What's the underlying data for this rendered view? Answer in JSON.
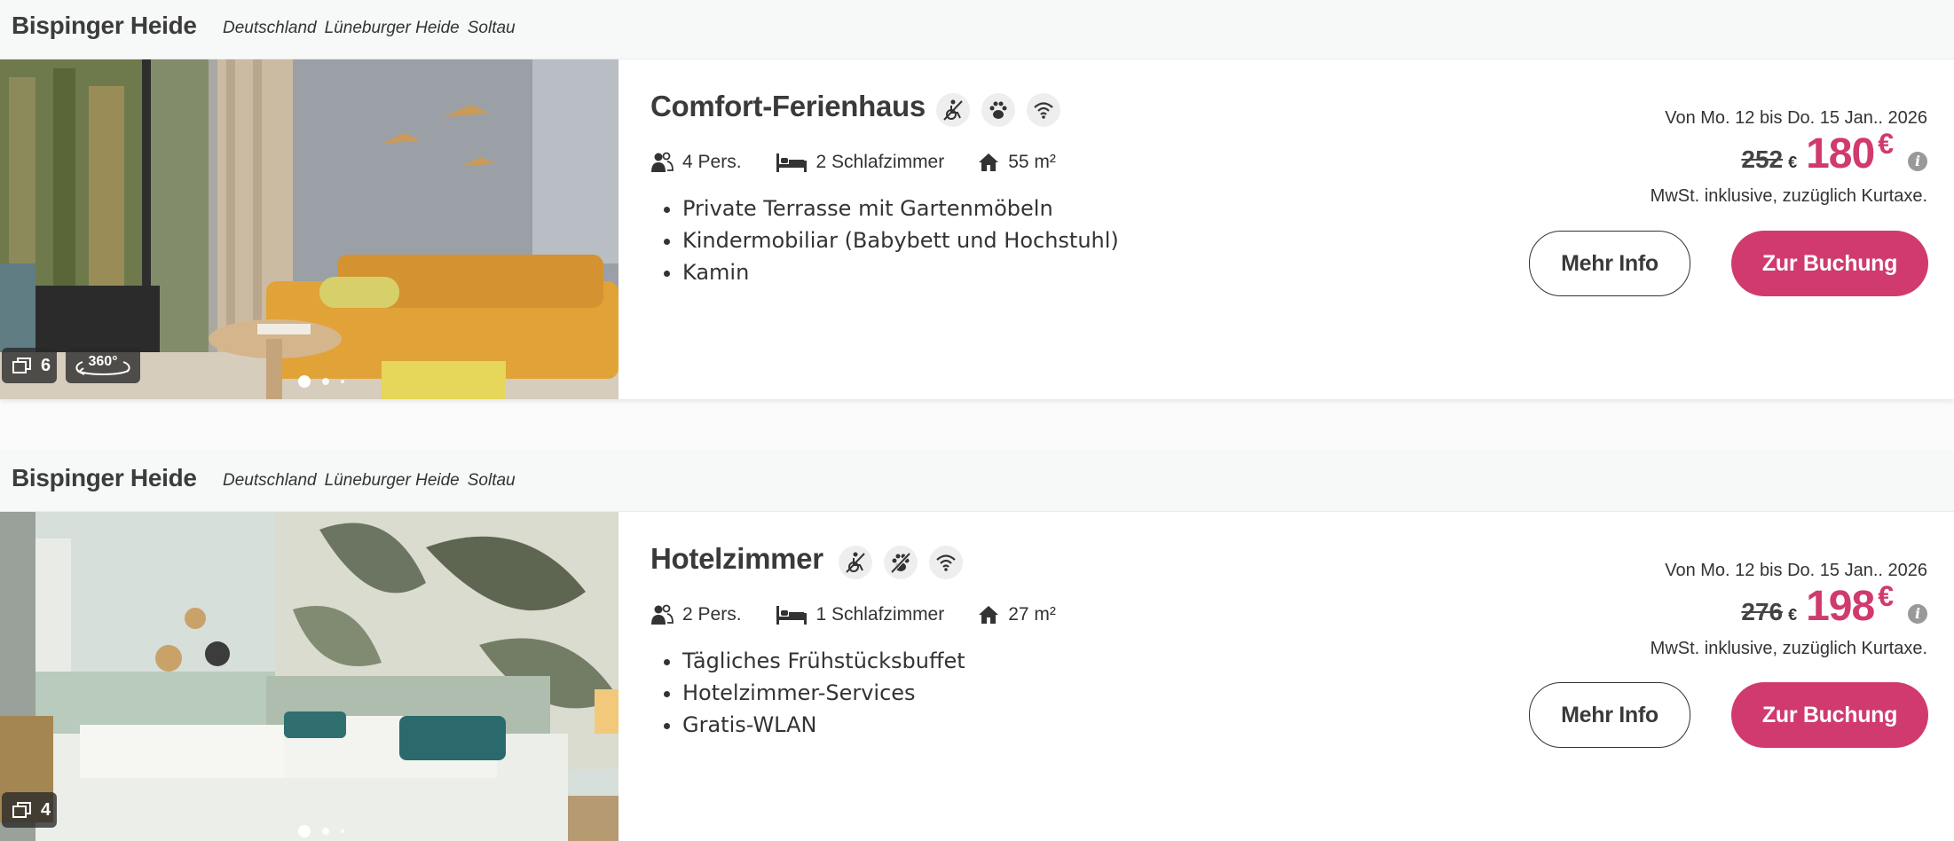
{
  "listings": [
    {
      "location": "Bispinger Heide",
      "breadcrumb": [
        "Deutschland",
        "Lüneburger Heide",
        "Soltau"
      ],
      "photo_count": "6",
      "has_360": true,
      "badge_360_label": "360°",
      "title": "Comfort-Ferienhaus",
      "amenities": [
        "no-wheelchair-icon",
        "pets-allowed-icon",
        "wifi-icon"
      ],
      "persons": "4 Pers.",
      "bedrooms": "2 Schlafzimmer",
      "area": "55 m²",
      "features": [
        "Private Terrasse mit Gartenmöbeln",
        "Kindermobiliar (Babybett und Hochstuhl)",
        "Kamin"
      ],
      "date_range": "Von Mo. 12 bis Do. 15 Jan.. 2026",
      "old_price": "252",
      "currency": "€",
      "new_price": "180",
      "tax_note": "MwSt. inklusive, zuzüglich Kurtaxe.",
      "more_info_label": "Mehr Info",
      "book_label": "Zur Buchung"
    },
    {
      "location": "Bispinger Heide",
      "breadcrumb": [
        "Deutschland",
        "Lüneburger Heide",
        "Soltau"
      ],
      "photo_count": "4",
      "has_360": false,
      "title": "Hotelzimmer",
      "amenities": [
        "no-wheelchair-icon",
        "no-pets-icon",
        "wifi-icon"
      ],
      "persons": "2 Pers.",
      "bedrooms": "1 Schlafzimmer",
      "area": "27 m²",
      "features": [
        "Tägliches Frühstücksbuffet",
        "Hotelzimmer-Services",
        "Gratis-WLAN"
      ],
      "date_range": "Von Mo. 12 bis Do. 15 Jan.. 2026",
      "old_price": "276",
      "currency": "€",
      "new_price": "198",
      "tax_note": "MwSt. inklusive, zuzüglich Kurtaxe.",
      "more_info_label": "Mehr Info",
      "book_label": "Zur Buchung"
    }
  ],
  "colors": {
    "accent": "#d03a6e",
    "header_bg": "#f7f9f9"
  }
}
